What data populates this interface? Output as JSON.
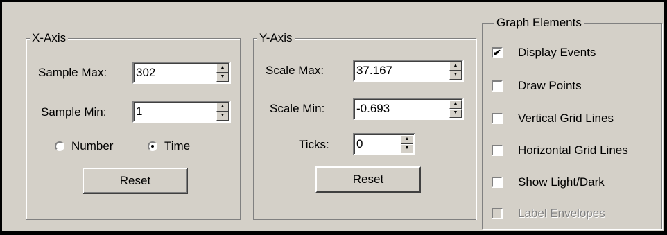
{
  "x_axis": {
    "title": "X-Axis",
    "sample_max_label": "Sample Max:",
    "sample_max_value": "302",
    "sample_min_label": "Sample Min:",
    "sample_min_value": "1",
    "radio_number_label": "Number",
    "radio_time_label": "Time",
    "selected_radio": "Time",
    "reset_label": "Reset"
  },
  "y_axis": {
    "title": "Y-Axis",
    "scale_max_label": "Scale Max:",
    "scale_max_value": "37.167",
    "scale_min_label": "Scale Min:",
    "scale_min_value": "-0.693",
    "ticks_label": "Ticks:",
    "ticks_value": "0",
    "reset_label": "Reset"
  },
  "graph_elements": {
    "title": "Graph Elements",
    "items": [
      {
        "label": "Display Events",
        "checked": true,
        "enabled": true
      },
      {
        "label": "Draw Points",
        "checked": false,
        "enabled": true
      },
      {
        "label": "Vertical Grid Lines",
        "checked": false,
        "enabled": true
      },
      {
        "label": "Horizontal Grid Lines",
        "checked": false,
        "enabled": true
      },
      {
        "label": "Show Light/Dark",
        "checked": false,
        "enabled": true
      },
      {
        "label": "Label Envelopes",
        "checked": false,
        "enabled": false
      }
    ]
  },
  "colors": {
    "face": "#d4d0c8",
    "shadow": "#808080",
    "highlight": "#ffffff",
    "disabled_text": "#808080"
  }
}
